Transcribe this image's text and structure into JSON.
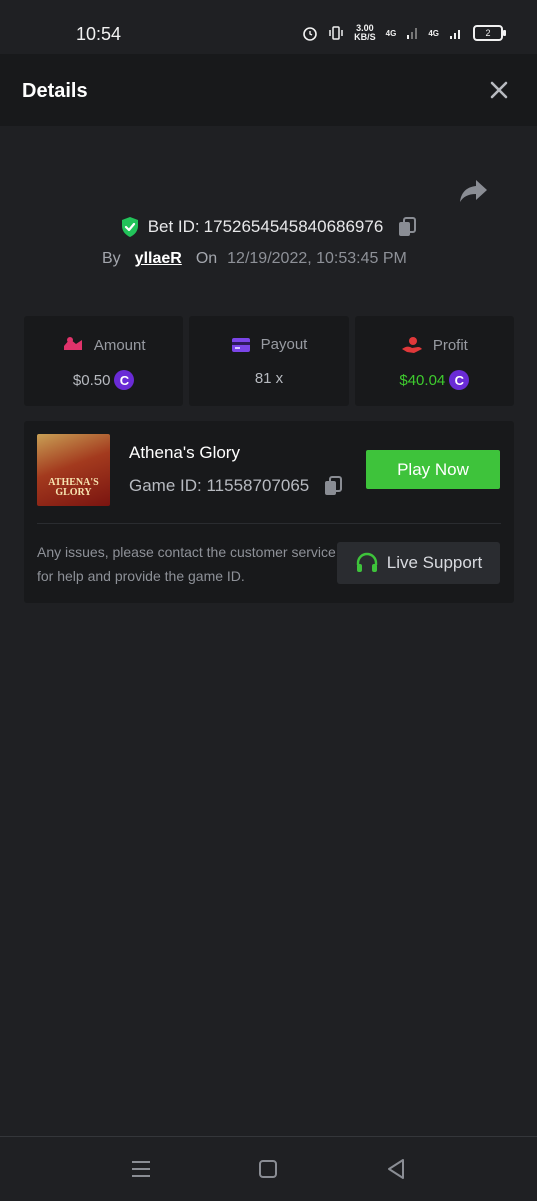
{
  "status_bar": {
    "time": "10:54",
    "net_speed_value": "3.00",
    "net_speed_unit": "KB/S",
    "net1": "4G",
    "net2": "4G",
    "battery": "2"
  },
  "header": {
    "title": "Details"
  },
  "bet": {
    "id_label": "Bet ID:",
    "id_value": "1752654545840686976",
    "by_label": "By",
    "user": "yllaeR",
    "on_label": "On",
    "datetime": "12/19/2022, 10:53:45 PM"
  },
  "stats": {
    "amount": {
      "label": "Amount",
      "value": "$0.50"
    },
    "payout": {
      "label": "Payout",
      "value": "81 x"
    },
    "profit": {
      "label": "Profit",
      "value": "$40.04"
    },
    "coin_symbol": "C"
  },
  "game": {
    "name": "Athena's Glory",
    "id_label": "Game ID:",
    "id_value": "11558707065",
    "thumb_text": "ATHENA'S GLORY",
    "play_label": "Play Now",
    "support_text": "Any issues, please contact the customer service for help and provide the game ID.",
    "support_label": "Live Support"
  },
  "colors": {
    "background": "#1f2023",
    "card": "#18191b",
    "accent_green": "#3ec33b",
    "profit_green": "#3ecb2e",
    "coin_purple": "#6a2bd6",
    "amount_pink": "#e0336b",
    "payout_purple": "#7b45e8",
    "profit_red": "#e0383a"
  }
}
